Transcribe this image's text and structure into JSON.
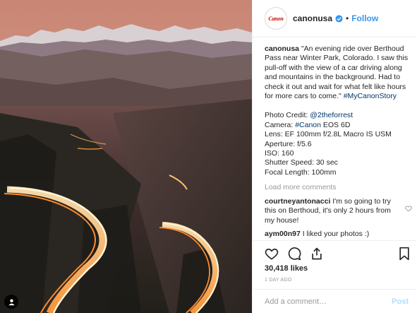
{
  "photo": {
    "description_icon": "user-tag-icon"
  },
  "account": {
    "avatar_text": "Canon",
    "username": "canonusa",
    "follow_label": "Follow",
    "separator": "•"
  },
  "caption": {
    "username": "canonusa",
    "text": "\"An evening ride over Berthoud Pass near Winter Park, Colorado. I saw this pull-off with the view of a car driving along and mountains in the background. Had to check it out and wait for what felt like hours for more cars to come.\"",
    "hashtag": "#MyCanonStory",
    "credits": {
      "photo_credit_label": "Photo Credit:",
      "photo_credit_handle": "@2theforrest",
      "camera_label": "Camera:",
      "camera_tag": "#Canon",
      "camera_model": "EOS 6D",
      "lens": "Lens: EF 100mm f/2.8L Macro IS USM",
      "aperture": "Aperture: f/5.6",
      "iso": "ISO: 160",
      "shutter": "Shutter Speed: 30 sec",
      "focal": "Focal Length: 100mm"
    }
  },
  "load_more": "Load more comments",
  "comments": [
    {
      "username": "courtneyantonacci",
      "text": "I'm so going to try this on Berthoud, it's only 2 hours from my house!"
    },
    {
      "username": "aym00n97",
      "text": "I liked your photos :)"
    }
  ],
  "likes": "30,418 likes",
  "time_ago": "1 DAY AGO",
  "add_comment": {
    "placeholder": "Add a comment…",
    "post_label": "Post"
  },
  "colors": {
    "link": "#3897f0",
    "hashtag": "#003569",
    "muted": "#999999",
    "text": "#262626",
    "post_disabled": "#b2dffc"
  }
}
